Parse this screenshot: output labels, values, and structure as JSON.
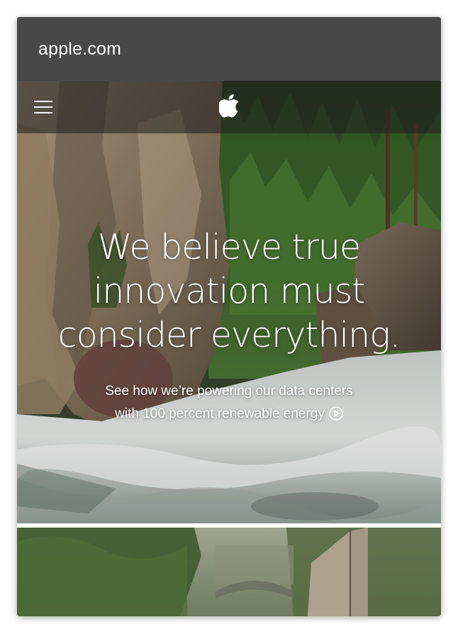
{
  "browser": {
    "url": "apple.com"
  },
  "nav": {
    "menu_icon": "hamburger-menu-icon",
    "logo_icon": "apple-logo-icon"
  },
  "hero": {
    "headline_lines": [
      "We believe true",
      "innovation must",
      "consider everything."
    ],
    "subline_line1": "See how we’re powering our data centers",
    "subline_line2": "with 100 percent renewable energy",
    "cta_icon": "play-circle-icon"
  },
  "colors": {
    "url_bar": "#484848",
    "text": "#ffffff"
  }
}
